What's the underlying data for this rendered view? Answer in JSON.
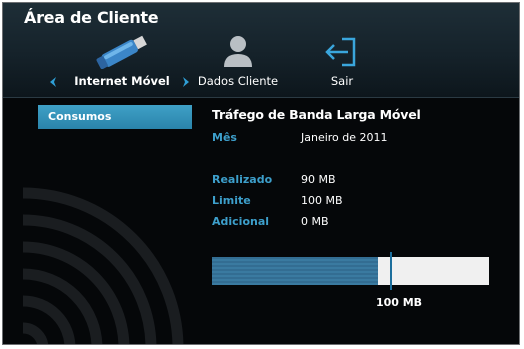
{
  "header": {
    "title": "Área de Cliente"
  },
  "nav": {
    "items": [
      {
        "label": "Internet Móvel",
        "icon": "usb-modem-icon",
        "active": true
      },
      {
        "label": "Dados Cliente",
        "icon": "user-icon",
        "active": false
      },
      {
        "label": "Sair",
        "icon": "logout-icon",
        "active": false
      }
    ]
  },
  "sidebar": {
    "items": [
      {
        "label": "Consumos",
        "selected": true
      }
    ]
  },
  "main": {
    "title": "Tráfego de Banda Larga Móvel",
    "month_label": "Mês",
    "month_value": "Janeiro de 2011",
    "fields": [
      {
        "label": "Realizado",
        "value": "90 MB"
      },
      {
        "label": "Limite",
        "value": "100 MB"
      },
      {
        "label": "Adicional",
        "value": "0 MB"
      }
    ],
    "usage": {
      "used_mb": 90,
      "limit_mb": 100,
      "bar_max_mb": 150,
      "marker_label": "100 MB"
    }
  },
  "colors": {
    "accent": "#3d9fcb",
    "sidebar_selected": "#2f8ab2",
    "bar_fill": "#3a7aa0",
    "bar_track": "#f0f0f0"
  }
}
